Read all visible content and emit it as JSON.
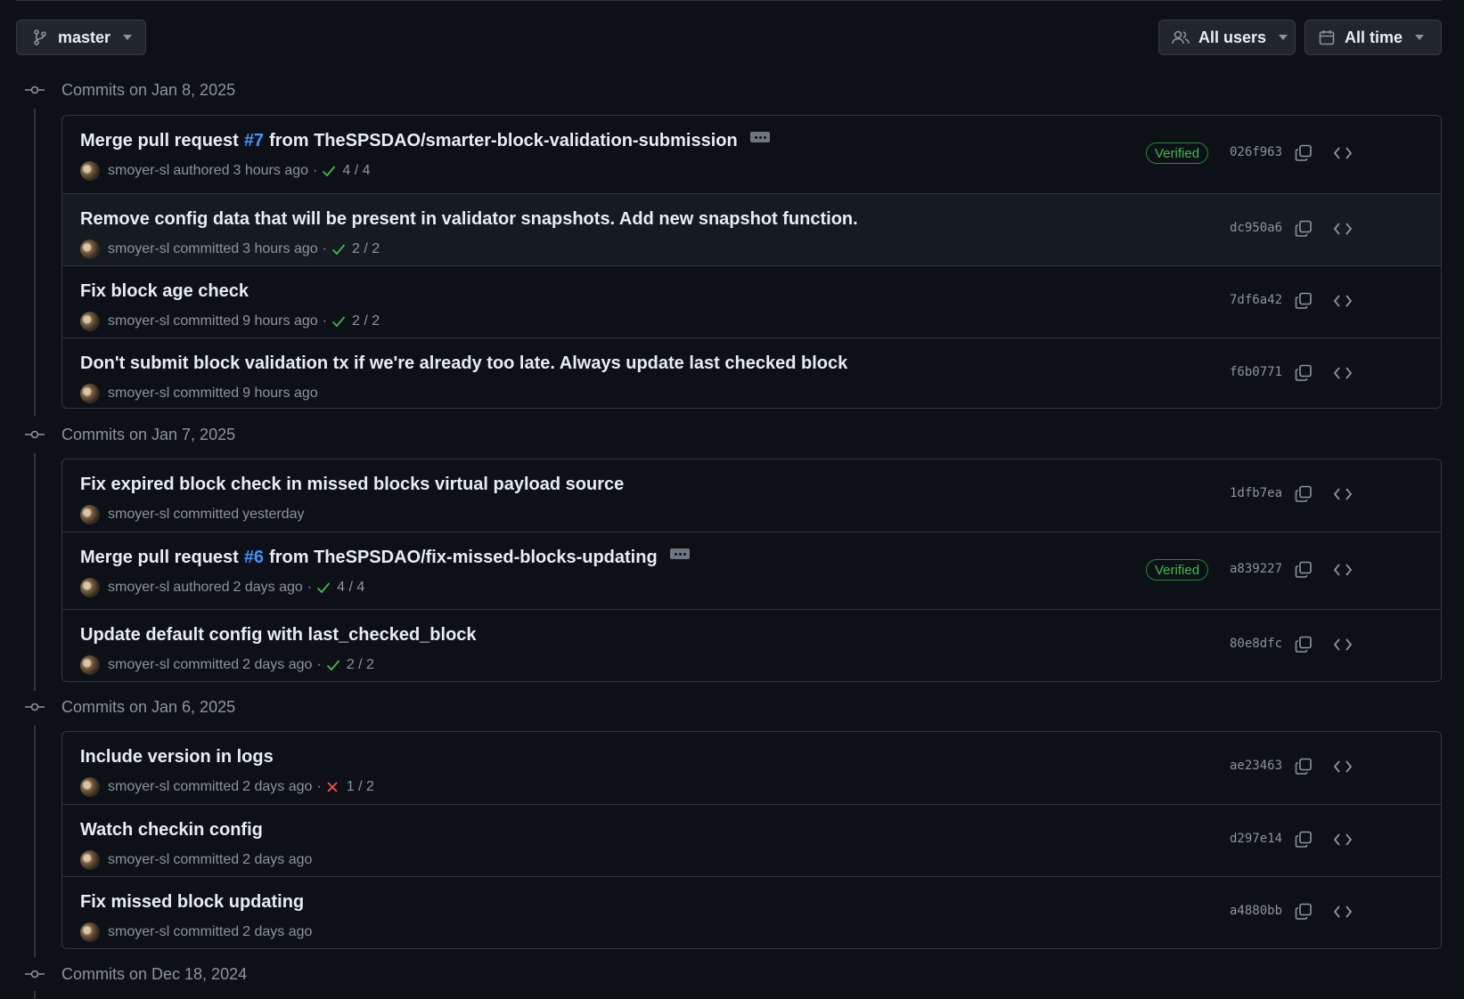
{
  "toolbar": {
    "branch": {
      "label": "master",
      "icon": "git-branch-icon"
    },
    "users_filter": {
      "label": "All users",
      "icon": "people-icon"
    },
    "time_filter": {
      "label": "All time",
      "icon": "calendar-icon"
    }
  },
  "colors": {
    "background": "#0d1117",
    "border": "#30363d",
    "muted_text": "#8b949e",
    "link": "#4493f8",
    "success": "#3fb950",
    "danger": "#f85149",
    "verified_border": "#238636"
  },
  "groups": [
    {
      "title": "Commits on Jan 8, 2025",
      "commits": [
        {
          "message_pre": "Merge pull request ",
          "pr": "#7",
          "message_post": " from TheSPSDAO/smarter-block-validation-submission",
          "has_ellipsis": true,
          "author": "smoyer-sl",
          "verb": "authored",
          "when": "3 hours ago",
          "check_status": "success",
          "checks": "4 / 4",
          "verified": "Verified",
          "sha": "026f963"
        },
        {
          "message_pre": "Remove config data that will be present in validator snapshots. Add new snapshot function.",
          "author": "smoyer-sl",
          "verb": "committed",
          "when": "3 hours ago",
          "check_status": "success",
          "checks": "2 / 2",
          "sha": "dc950a6",
          "highlighted": true
        },
        {
          "message_pre": "Fix block age check",
          "author": "smoyer-sl",
          "verb": "committed",
          "when": "9 hours ago",
          "check_status": "success",
          "checks": "2 / 2",
          "sha": "7df6a42"
        },
        {
          "message_pre": "Don't submit block validation tx if we're already too late. Always update last checked block",
          "author": "smoyer-sl",
          "verb": "committed",
          "when": "9 hours ago",
          "sha": "f6b0771"
        }
      ]
    },
    {
      "title": "Commits on Jan 7, 2025",
      "commits": [
        {
          "message_pre": "Fix expired block check in missed blocks virtual payload source",
          "author": "smoyer-sl",
          "verb": "committed",
          "when": "yesterday",
          "sha": "1dfb7ea"
        },
        {
          "message_pre": "Merge pull request ",
          "pr": "#6",
          "message_post": " from TheSPSDAO/fix-missed-blocks-updating",
          "has_ellipsis": true,
          "author": "smoyer-sl",
          "verb": "authored",
          "when": "2 days ago",
          "check_status": "success",
          "checks": "4 / 4",
          "verified": "Verified",
          "sha": "a839227"
        },
        {
          "message_pre": "Update default config with last_checked_block",
          "author": "smoyer-sl",
          "verb": "committed",
          "when": "2 days ago",
          "check_status": "success",
          "checks": "2 / 2",
          "sha": "80e8dfc"
        }
      ]
    },
    {
      "title": "Commits on Jan 6, 2025",
      "commits": [
        {
          "message_pre": "Include version in logs",
          "author": "smoyer-sl",
          "verb": "committed",
          "when": "2 days ago",
          "check_status": "failure",
          "checks": "1 / 2",
          "sha": "ae23463"
        },
        {
          "message_pre": "Watch checkin config",
          "author": "smoyer-sl",
          "verb": "committed",
          "when": "2 days ago",
          "sha": "d297e14"
        },
        {
          "message_pre": "Fix missed block updating",
          "author": "smoyer-sl",
          "verb": "committed",
          "when": "2 days ago",
          "sha": "a4880bb"
        }
      ]
    },
    {
      "title": "Commits on Dec 18, 2024",
      "commits": []
    }
  ]
}
